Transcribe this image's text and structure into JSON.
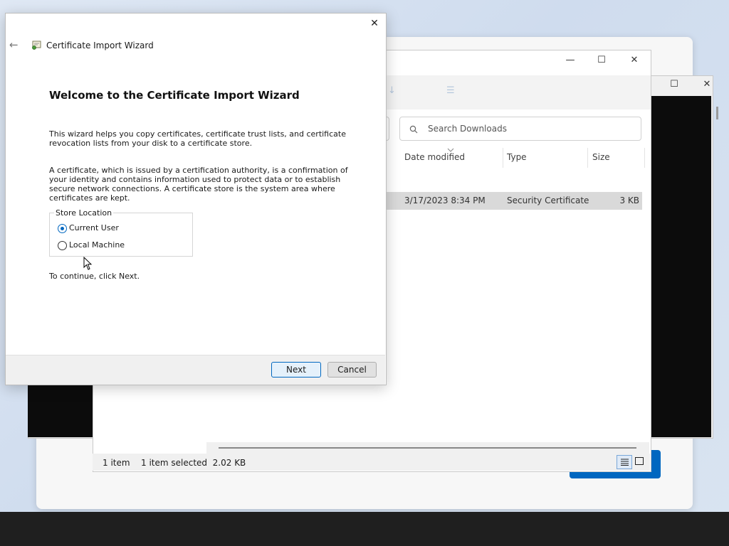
{
  "wizard": {
    "window_title": "Certificate Import Wizard",
    "heading": "Welcome to the Certificate Import Wizard",
    "paragraph1": "This wizard helps you copy certificates, certificate trust lists, and certificate revocation lists from your disk to a certificate store.",
    "paragraph2": "A certificate, which is issued by a certification authority, is a confirmation of your identity and contains information used to protect data or to establish secure network connections. A certificate store is the system area where certificates are kept.",
    "store_location_legend": "Store Location",
    "options": [
      {
        "label": "Current User",
        "selected": true
      },
      {
        "label": "Local Machine",
        "selected": false
      }
    ],
    "continue_hint": "To continue, click Next.",
    "next_label": "Next",
    "cancel_label": "Cancel",
    "close_glyph": "✕",
    "back_glyph": "←"
  },
  "explorer": {
    "search_placeholder": "Search Downloads",
    "columns": [
      "Date modified",
      "Type",
      "Size"
    ],
    "toolbar_ghost": [
      "↓",
      "☰"
    ],
    "row": {
      "date": "3/17/2023 8:34 PM",
      "type": "Security Certificate",
      "size": "3 KB"
    },
    "status_items": "1 item",
    "status_selected": "1 item selected  2.02 KB",
    "minimize_glyph": "—",
    "maximize_glyph": "☐",
    "close_glyph": "✕"
  },
  "terminal": {
    "maximize_glyph": "☐",
    "close_glyph": "✕"
  },
  "colors": {
    "accent": "#0067c0",
    "selection_row": "#d9d9d9",
    "taskbar": "#1f1f1f"
  }
}
